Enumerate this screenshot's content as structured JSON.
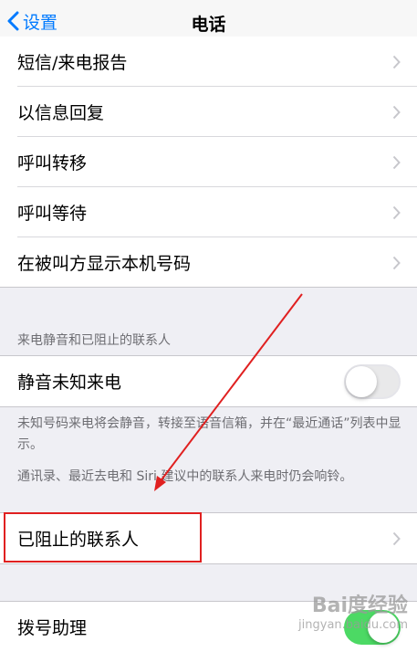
{
  "nav": {
    "back_label": "设置",
    "title": "电话"
  },
  "group1": {
    "items": [
      {
        "label": "短信/来电报告"
      },
      {
        "label": "以信息回复"
      },
      {
        "label": "呼叫转移"
      },
      {
        "label": "呼叫等待"
      },
      {
        "label": "在被叫方显示本机号码"
      }
    ]
  },
  "silence": {
    "section_header": "来电静音和已阻止的联系人",
    "toggle_label": "静音未知来电",
    "toggle_on": false,
    "footer1": "未知号码来电将会静音，转接至语音信箱，并在“最近通话”列表中显示。",
    "footer2": "通讯录、最近去电和 Siri 建议中的联系人来电时仍会响铃。"
  },
  "blocked": {
    "label": "已阻止的联系人"
  },
  "dial_assist": {
    "label": "拨号助理",
    "toggle_on": true
  },
  "annotation": {
    "box_color": "#e02020",
    "arrow_color": "#e02020"
  },
  "watermark": {
    "logo_text": "Bai度经验",
    "sub_text": "jingyan.baidu.com"
  },
  "colors": {
    "accent": "#007aff",
    "switch_on": "#4cd964",
    "background": "#efeff4"
  }
}
